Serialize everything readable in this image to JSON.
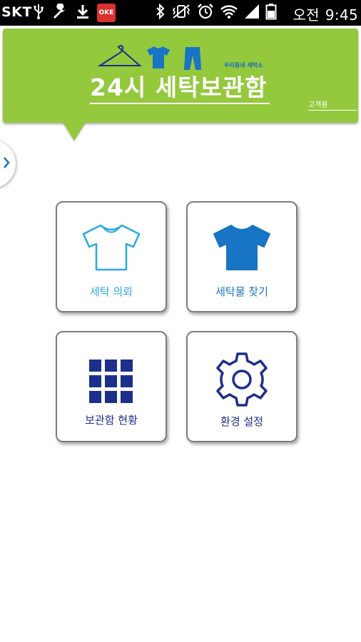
{
  "status_bar": {
    "carrier": "SKT",
    "ampm": "오전",
    "time": "9:45",
    "notification_app_label": "OKE",
    "left_icons": [
      "usb-icon",
      "wrench-icon",
      "download-icon",
      "okcashbag-app-icon"
    ],
    "right_icons": [
      "bluetooth-icon",
      "vibrate-mute-icon",
      "alarm-icon",
      "wifi-icon",
      "signal-icon",
      "battery-icon"
    ]
  },
  "header": {
    "subtitle": "우리동네 세탁소",
    "title": "24시 세탁보관함",
    "mode_label": "고객용"
  },
  "tiles": [
    {
      "label": "세탁 의뢰",
      "icon": "tshirt-outline-icon",
      "color": "#29a9e0"
    },
    {
      "label": "세탁물 찾기",
      "icon": "tshirt-filled-icon",
      "color": "#1874c4"
    },
    {
      "label": "보관함 현황",
      "icon": "grid-icon",
      "color": "#1c2f8c"
    },
    {
      "label": "환경 설정",
      "icon": "gear-icon",
      "color": "#1c2f8c"
    }
  ],
  "colors": {
    "banner": "#94c83d",
    "light_blue": "#29a9e0",
    "mid_blue": "#1874c4",
    "navy": "#1c2f8c"
  }
}
